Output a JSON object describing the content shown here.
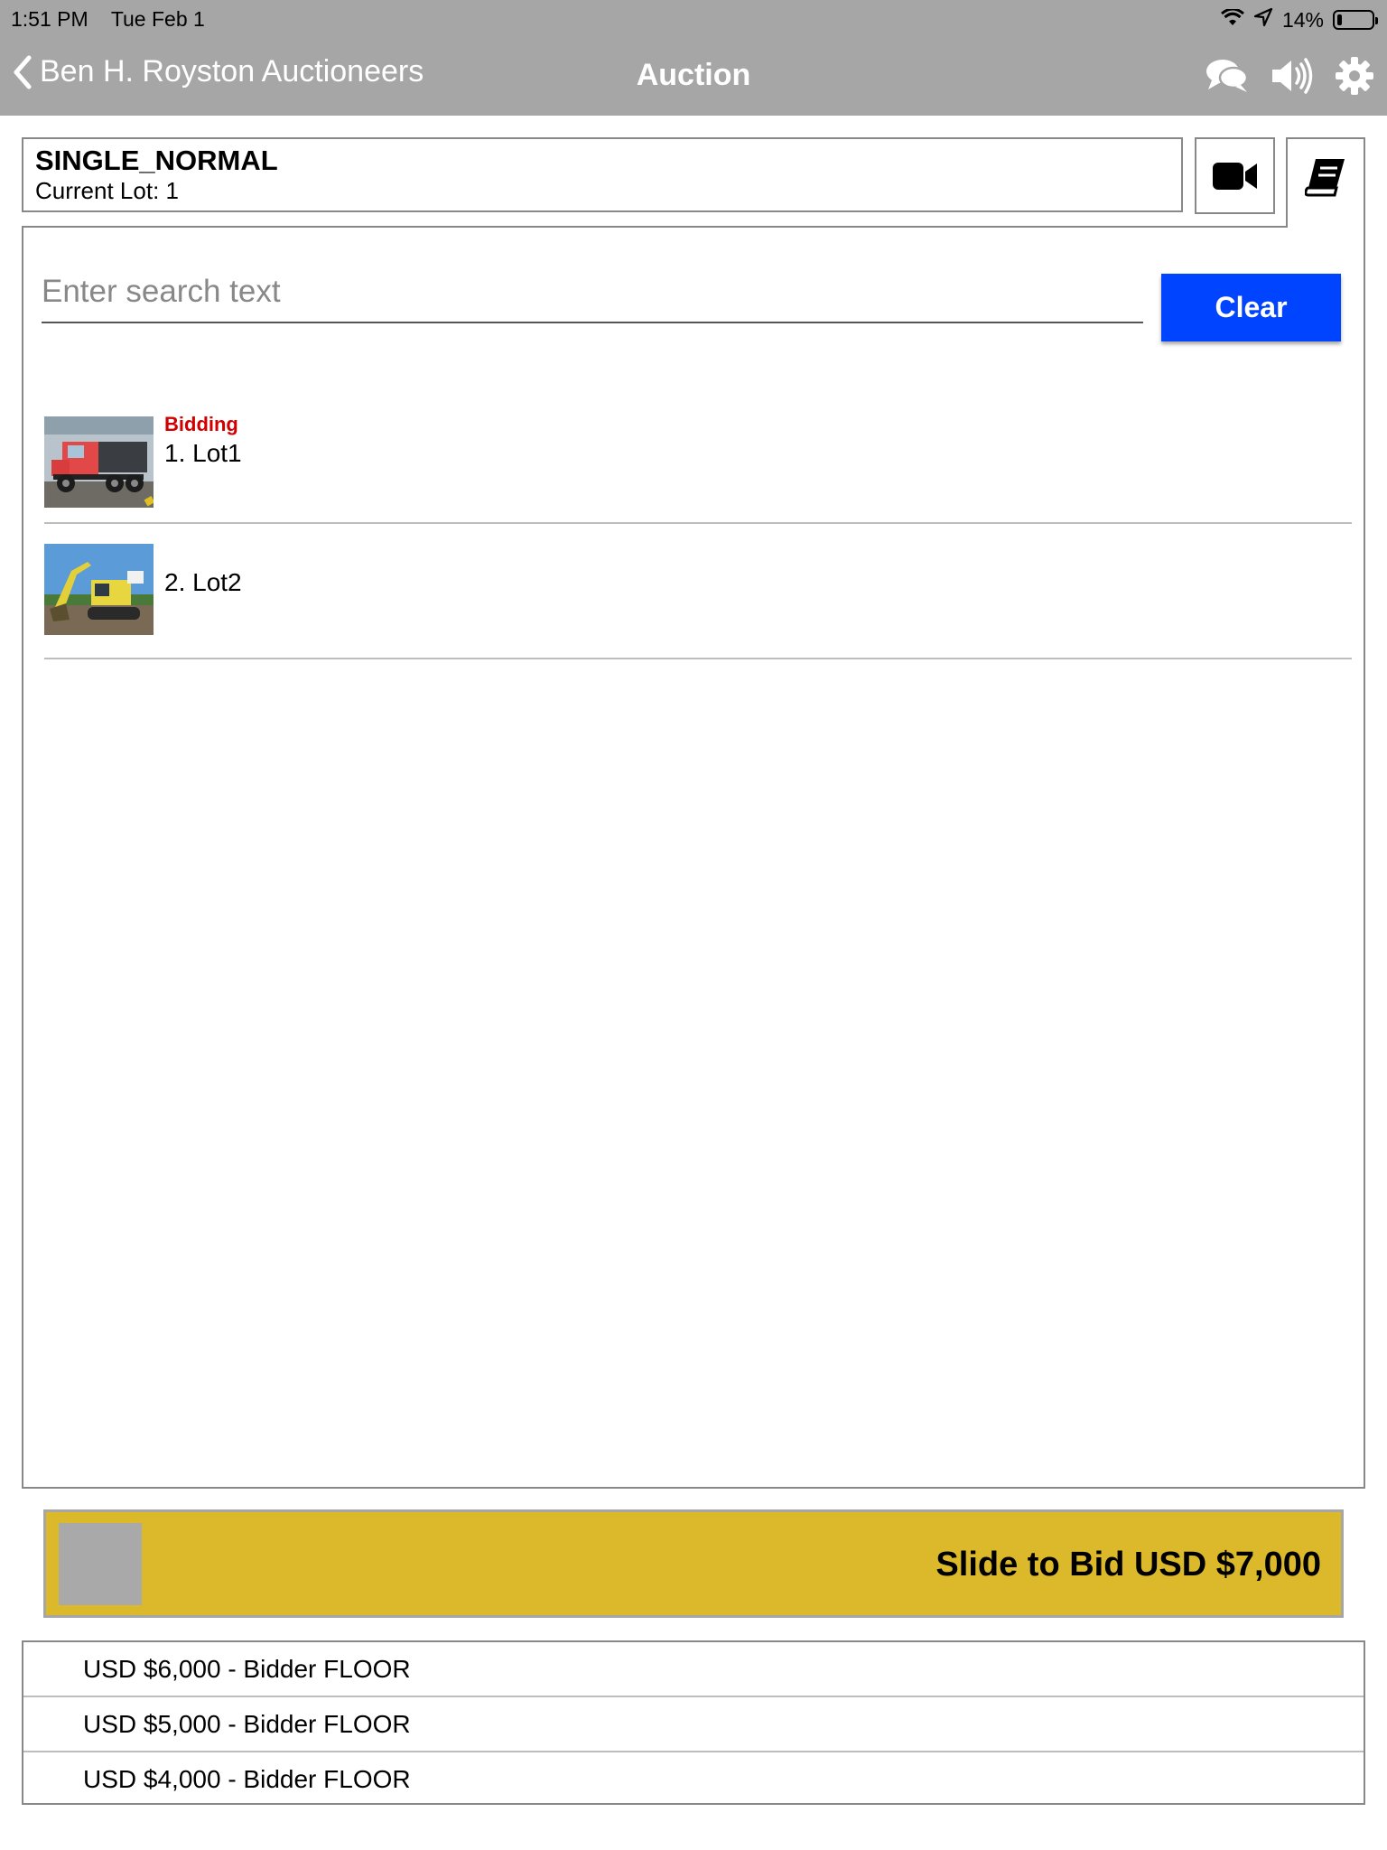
{
  "status_bar": {
    "time": "1:51 PM",
    "date": "Tue Feb 1",
    "battery": "14%",
    "battery_level": 0.14
  },
  "nav": {
    "back_label": "Ben H. Royston Auctioneers",
    "title": "Auction"
  },
  "auction": {
    "name": "SINGLE_NORMAL",
    "current_lot": "Current Lot: 1"
  },
  "search": {
    "placeholder": "Enter search text",
    "value": "",
    "clear_label": "Clear"
  },
  "lots": [
    {
      "status": "Bidding",
      "label": "1. Lot1",
      "thumbnail": "dump-truck"
    },
    {
      "status": "",
      "label": "2. Lot2",
      "thumbnail": "excavator"
    }
  ],
  "bid_slider": {
    "label": "Slide to Bid USD $7,000"
  },
  "bid_history": [
    "USD $6,000 - Bidder FLOOR",
    "USD $5,000 - Bidder FLOOR",
    "USD $4,000 - Bidder FLOOR"
  ],
  "icons": [
    "chevron-left-icon",
    "chat-icon",
    "speaker-icon",
    "gear-icon",
    "video-camera-icon",
    "book-icon",
    "wifi-icon",
    "location-icon",
    "battery-icon"
  ],
  "colors": {
    "nav_bar": "#a6a6a6",
    "clear_button": "#0044ff",
    "slider": "#dbb92b",
    "bidding_status": "#d00000"
  }
}
